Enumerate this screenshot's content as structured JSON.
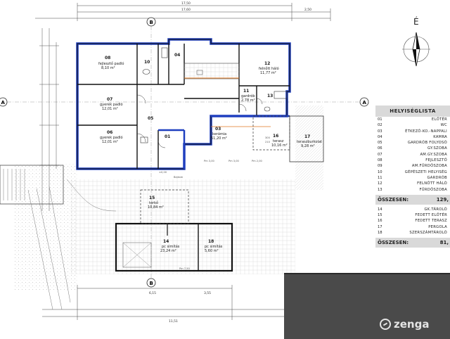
{
  "compass": {
    "letter": "É"
  },
  "legend": {
    "title": "HELYISÉGLISTA",
    "rows": [
      {
        "num": "01",
        "name": "Előtér"
      },
      {
        "num": "02",
        "name": "WC"
      },
      {
        "num": "03",
        "name": "Étkező-Ko.-Nappali"
      },
      {
        "num": "04",
        "name": "Kamra"
      },
      {
        "num": "05",
        "name": "Gardrób folyosó"
      },
      {
        "num": "06",
        "name": "Gy.szoba"
      },
      {
        "num": "07",
        "name": "Am.gy.szoba"
      },
      {
        "num": "08",
        "name": "Fejlesztő"
      },
      {
        "num": "09",
        "name": "Am.fürdőszoba"
      },
      {
        "num": "10",
        "name": "Gépészeti helyiség"
      },
      {
        "num": "11",
        "name": "Gardrób"
      },
      {
        "num": "12",
        "name": "Felnőtt háló"
      },
      {
        "num": "13",
        "name": "Fürdőszoba"
      }
    ],
    "total1_label": "ÖSSZESEN:",
    "total1_value": "129,",
    "rows2": [
      {
        "num": "14",
        "name": "Gk.tároló"
      },
      {
        "num": "15",
        "name": "Fedett előtér"
      },
      {
        "num": "16",
        "name": "Fedett terasz"
      },
      {
        "num": "17",
        "name": "Pergola"
      },
      {
        "num": "18",
        "name": "Szerszámtároló"
      }
    ],
    "total2_label": "ÖSSZESEN:",
    "total2_value": "81,"
  },
  "rooms": [
    {
      "num": "08",
      "name": "fejlesztő padló",
      "area": "8,10 m²"
    },
    {
      "num": "10",
      "name": "",
      "area": ""
    },
    {
      "num": "04",
      "name": "",
      "area": ""
    },
    {
      "num": "12",
      "name": "felnőtt háló",
      "area": "11,77 m²"
    },
    {
      "num": "07",
      "name": "gyerek padló",
      "area": "12,01 m²"
    },
    {
      "num": "11",
      "name": "gardrób",
      "area": "2,78 m²"
    },
    {
      "num": "13",
      "name": "",
      "area": ""
    },
    {
      "num": "06",
      "name": "gyerek padló",
      "area": "12,01 m²"
    },
    {
      "num": "05",
      "name": "",
      "area": ""
    },
    {
      "num": "01",
      "name": "",
      "area": ""
    },
    {
      "num": "03",
      "name": "kerámia",
      "area": "51,20 m²"
    },
    {
      "num": "16",
      "name": "terasz",
      "area": "10,16 m²"
    },
    {
      "num": "17",
      "name": "teraszburkolat",
      "area": "9,28 m²"
    },
    {
      "num": "15",
      "name": "térkő",
      "area": "10,84 m²"
    },
    {
      "num": "14",
      "name": "pc simítás",
      "area": "23,24 m²"
    },
    {
      "num": "18",
      "name": "pc simítás",
      "area": "5,60 m²"
    }
  ],
  "axis_labels": {
    "top": "B",
    "left": "A",
    "right": "A",
    "bottom": "B"
  },
  "dimensions": {
    "top_total": "17,50",
    "top_mid": "17,60",
    "top_right": "2,50",
    "bottom_a": "6,15",
    "bottom_b": "3,55",
    "bottom_total": "11,51",
    "pm_a": "Pm 3,00",
    "pm_b": "Pm 7,50",
    "pm_c": "Pm 2,00",
    "pm_d": "Pm 3,00",
    "h_a": "300",
    "h_b": "210",
    "elev": "±0,00",
    "bejarat": "Bejárat"
  },
  "brand": {
    "name": "zenga"
  }
}
